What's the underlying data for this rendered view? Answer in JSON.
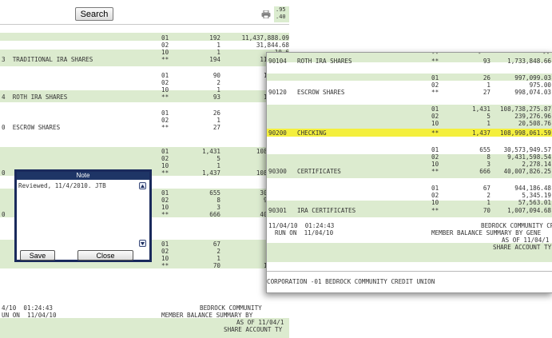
{
  "toolbar": {
    "search_label": "Search",
    "corner_line1": ".95",
    "corner_line2": ".40"
  },
  "back_rows": [
    [
      "",
      "01",
      "192",
      "11,437,888.09"
    ],
    [
      "",
      "02",
      "1",
      "31,844.68"
    ],
    [
      "",
      "10",
      "1",
      "10,6"
    ],
    [
      "3  TRADITIONAL IRA SHARES",
      "**",
      "194",
      "11,480,3"
    ],
    [
      "",
      "01",
      "90",
      "1,724,9"
    ],
    [
      "",
      "02",
      "2",
      "8,9"
    ],
    [
      "",
      "10",
      "1",
      ""
    ],
    [
      "4  ROTH IRA SHARES",
      "**",
      "93",
      "1,733,8"
    ],
    [
      "",
      "01",
      "26",
      "997,0"
    ],
    [
      "",
      "02",
      "1",
      "9"
    ],
    [
      "0  ESCROW SHARES",
      "**",
      "27",
      "998,0"
    ],
    [
      "",
      "01",
      "1,431",
      "108,738,2"
    ],
    [
      "",
      "02",
      "5",
      "239,2"
    ],
    [
      "",
      "10",
      "1",
      "20,5"
    ],
    [
      "0",
      "**",
      "1,437",
      "108,998,0"
    ],
    [
      "",
      "01",
      "655",
      "30,573,9"
    ],
    [
      "",
      "02",
      "8",
      "9,431,5"
    ],
    [
      "",
      "10",
      "3",
      "2,2"
    ],
    [
      "0",
      "**",
      "666",
      "40,007,8"
    ],
    [
      "",
      "01",
      "67",
      "944,1"
    ],
    [
      "",
      "02",
      "2",
      "5,3"
    ],
    [
      "",
      "10",
      "1",
      "57,5"
    ],
    [
      "",
      "**",
      "70",
      "1,007,0"
    ]
  ],
  "back_footer": {
    "line1_left": "4/10  01:24:43",
    "line1_right": "BEDROCK COMMUNITY",
    "line2_left": "UN ON  11/04/10",
    "line2_right": "MEMBER BALANCE SUMMARY BY",
    "line3": "AS OF 11/04/1",
    "line4": "SHARE ACCOUNT TY"
  },
  "note": {
    "title": "Note",
    "text": "Reviewed, 11/4/2010. JTB",
    "save_label": "Save",
    "close_label": "Close"
  },
  "front_rows": [
    [
      "90104",
      "ROTH IRA SHARES",
      "**",
      "93",
      "1,733,848.66"
    ],
    [
      "",
      "",
      "01",
      "26",
      "997,099.03"
    ],
    [
      "",
      "",
      "02",
      "1",
      "975.00"
    ],
    [
      "90120",
      "ESCROW SHARES",
      "**",
      "27",
      "998,074.03"
    ],
    [
      "",
      "",
      "01",
      "1,431",
      "108,738,275.87"
    ],
    [
      "",
      "",
      "02",
      "5",
      "239,276.96"
    ],
    [
      "",
      "",
      "10",
      "1",
      "20,508.76"
    ],
    [
      "90200",
      "CHECKING",
      "**",
      "1,437",
      "108,998,061.59"
    ],
    [
      "",
      "",
      "01",
      "655",
      "30,573,949.57"
    ],
    [
      "",
      "",
      "02",
      "8",
      "9,431,598.54"
    ],
    [
      "",
      "",
      "10",
      "3",
      "2,278.14"
    ],
    [
      "90300",
      "CERTIFICATES",
      "**",
      "666",
      "40,007,826.25"
    ],
    [
      "",
      "",
      "01",
      "67",
      "944,186.48"
    ],
    [
      "",
      "",
      "02",
      "2",
      "5,345.19"
    ],
    [
      "",
      "",
      "10",
      "1",
      "57,563.01"
    ],
    [
      "90301",
      "IRA CERTIFICATES",
      "**",
      "70",
      "1,007,094.68"
    ]
  ],
  "front_footer": {
    "line1_left": "11/04/10  01:24:43",
    "line1_right": "BEDROCK COMMUNITY CRE",
    "line2_left": "RUN ON  11/04/10",
    "line2_right": "MEMBER BALANCE SUMMARY BY GENE",
    "line3": "AS OF 11/04/1",
    "line4": "SHARE ACCOUNT TY",
    "bottom": "CORPORATION -01 BEDROCK COMMUNITY CREDIT UNION"
  },
  "colors": {
    "band": "#dcebcf",
    "highlight": "#f4ef3d",
    "dialog_frame": "#1a2a5c"
  },
  "icons": [
    "print-icon",
    "scroll-up-icon",
    "scroll-down-icon"
  ]
}
